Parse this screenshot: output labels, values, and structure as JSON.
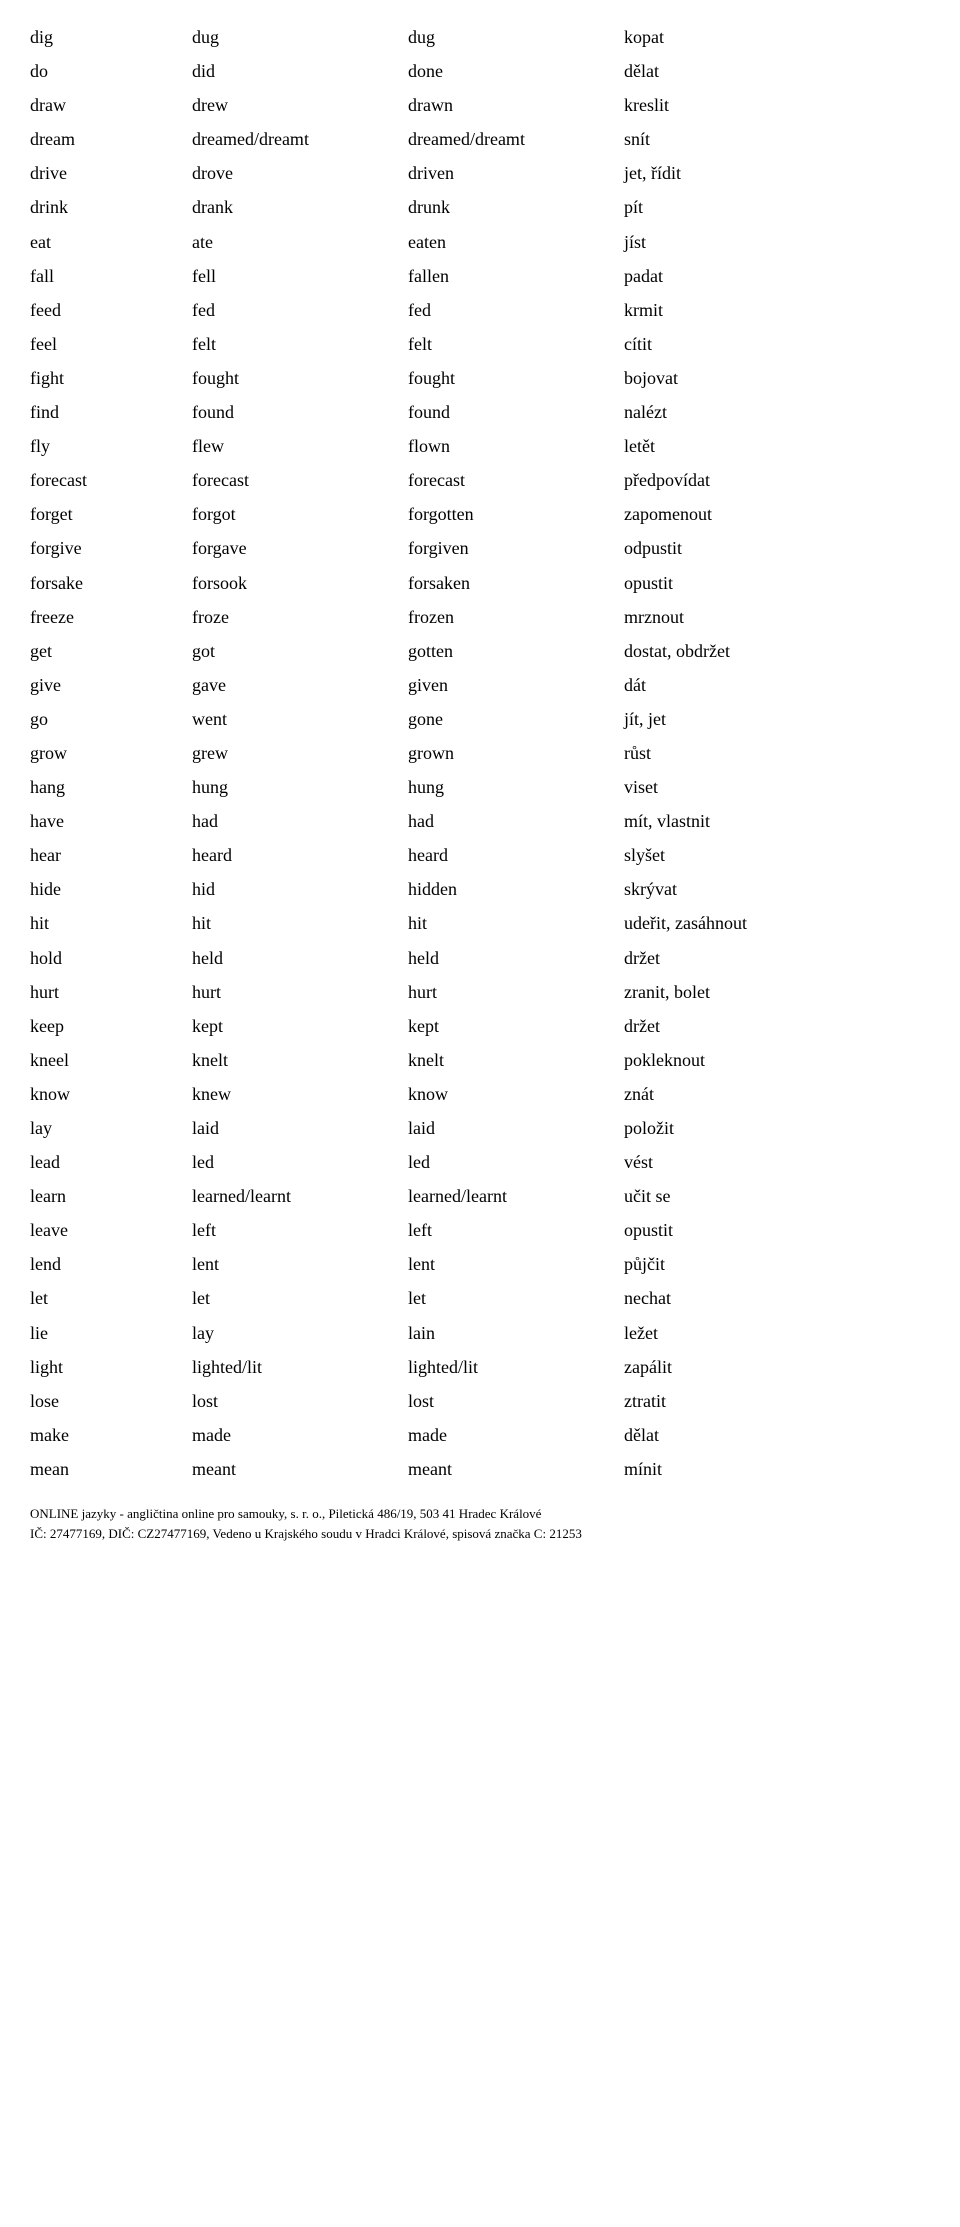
{
  "rows": [
    {
      "base": "dig",
      "past": "dug",
      "participle": "dug",
      "czech": "kopat"
    },
    {
      "base": "do",
      "past": "did",
      "participle": "done",
      "czech": "dělat"
    },
    {
      "base": "draw",
      "past": "drew",
      "participle": "drawn",
      "czech": "kreslit"
    },
    {
      "base": "dream",
      "past": "dreamed/dreamt",
      "participle": "dreamed/dreamt",
      "czech": "snít"
    },
    {
      "base": "drive",
      "past": "drove",
      "participle": "driven",
      "czech": "jet, řídit"
    },
    {
      "base": "drink",
      "past": "drank",
      "participle": "drunk",
      "czech": "pít"
    },
    {
      "base": "eat",
      "past": "ate",
      "participle": "eaten",
      "czech": "jíst"
    },
    {
      "base": "fall",
      "past": "fell",
      "participle": "fallen",
      "czech": "padat"
    },
    {
      "base": "feed",
      "past": "fed",
      "participle": "fed",
      "czech": "krmit"
    },
    {
      "base": "feel",
      "past": "felt",
      "participle": "felt",
      "czech": "cítit"
    },
    {
      "base": "fight",
      "past": "fought",
      "participle": "fought",
      "czech": "bojovat"
    },
    {
      "base": "find",
      "past": "found",
      "participle": "found",
      "czech": "nalézt"
    },
    {
      "base": "fly",
      "past": "flew",
      "participle": "flown",
      "czech": "letět"
    },
    {
      "base": "forecast",
      "past": "forecast",
      "participle": "forecast",
      "czech": "předpovídat"
    },
    {
      "base": "forget",
      "past": "forgot",
      "participle": "forgotten",
      "czech": "zapomenout"
    },
    {
      "base": "forgive",
      "past": "forgave",
      "participle": "forgiven",
      "czech": "odpustit"
    },
    {
      "base": "forsake",
      "past": "forsook",
      "participle": "forsaken",
      "czech": "opustit"
    },
    {
      "base": "freeze",
      "past": "froze",
      "participle": "frozen",
      "czech": "mrznout"
    },
    {
      "base": "get",
      "past": "got",
      "participle": "gotten",
      "czech": "dostat, obdržet"
    },
    {
      "base": "give",
      "past": "gave",
      "participle": "given",
      "czech": "dát"
    },
    {
      "base": "go",
      "past": "went",
      "participle": "gone",
      "czech": "jít, jet"
    },
    {
      "base": "grow",
      "past": "grew",
      "participle": "grown",
      "czech": "růst"
    },
    {
      "base": "hang",
      "past": "hung",
      "participle": "hung",
      "czech": "viset"
    },
    {
      "base": "have",
      "past": "had",
      "participle": "had",
      "czech": "mít, vlastnit"
    },
    {
      "base": "hear",
      "past": "heard",
      "participle": "heard",
      "czech": "slyšet"
    },
    {
      "base": "hide",
      "past": "hid",
      "participle": "hidden",
      "czech": "skrývat"
    },
    {
      "base": "hit",
      "past": "hit",
      "participle": "hit",
      "czech": "udeřit, zasáhnout"
    },
    {
      "base": "hold",
      "past": "held",
      "participle": "held",
      "czech": "držet"
    },
    {
      "base": "hurt",
      "past": "hurt",
      "participle": "hurt",
      "czech": "zranit, bolet"
    },
    {
      "base": "keep",
      "past": "kept",
      "participle": "kept",
      "czech": "držet"
    },
    {
      "base": "kneel",
      "past": "knelt",
      "participle": "knelt",
      "czech": "pokleknout"
    },
    {
      "base": "know",
      "past": "knew",
      "participle": "know",
      "czech": "znát"
    },
    {
      "base": "lay",
      "past": "laid",
      "participle": "laid",
      "czech": "položit"
    },
    {
      "base": "lead",
      "past": "led",
      "participle": "led",
      "czech": "vést"
    },
    {
      "base": "learn",
      "past": "learned/learnt",
      "participle": "learned/learnt",
      "czech": "učit se"
    },
    {
      "base": "leave",
      "past": "left",
      "participle": "left",
      "czech": "opustit"
    },
    {
      "base": "lend",
      "past": "lent",
      "participle": "lent",
      "czech": "půjčit"
    },
    {
      "base": "let",
      "past": "let",
      "participle": "let",
      "czech": "nechat"
    },
    {
      "base": "lie",
      "past": "lay",
      "participle": "lain",
      "czech": "ležet"
    },
    {
      "base": "light",
      "past": "lighted/lit",
      "participle": "lighted/lit",
      "czech": "zapálit"
    },
    {
      "base": "lose",
      "past": "lost",
      "participle": "lost",
      "czech": "ztratit"
    },
    {
      "base": "make",
      "past": "made",
      "participle": "made",
      "czech": "dělat"
    },
    {
      "base": "mean",
      "past": "meant",
      "participle": "meant",
      "czech": "mínit"
    }
  ],
  "footer": {
    "line1": "ONLINE jazyky - angličtina online pro samouky, s. r. o., Piletická 486/19, 503 41 Hradec Králové",
    "line2": "IČ: 27477169, DIČ: CZ27477169, Vedeno u Krajského soudu v Hradci Králové, spisová značka C: 21253"
  }
}
